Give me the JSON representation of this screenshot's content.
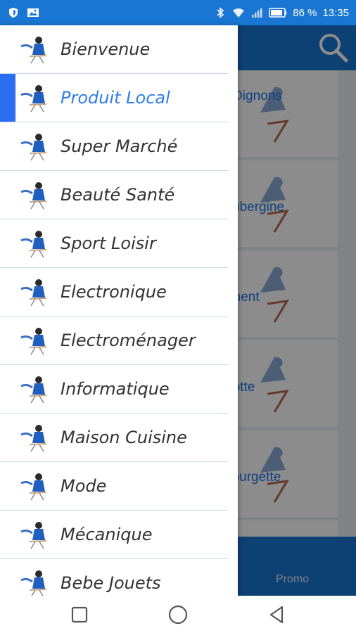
{
  "status_bar": {
    "battery": "86 %",
    "time": "13:35",
    "icons": [
      "shield-icon",
      "image-icon",
      "bluetooth-icon",
      "wifi-icon",
      "signal-icon",
      "battery-icon"
    ]
  },
  "app": {
    "cards": [
      "Oignons",
      "ubergine",
      "l Piment",
      "Carotte",
      "e Courgette",
      ""
    ],
    "bottom_tab": "Promo",
    "search_icon": "search-icon",
    "colors": {
      "primary": "#1976d2",
      "accent": "#2f7ee8",
      "active_bar": "#2b6ef2"
    }
  },
  "drawer": {
    "items": [
      {
        "label": "Bienvenue",
        "active": false
      },
      {
        "label": "Produit Local",
        "active": true
      },
      {
        "label": "Super Marché",
        "active": false
      },
      {
        "label": "Beauté Santé",
        "active": false
      },
      {
        "label": "Sport Loisir",
        "active": false
      },
      {
        "label": "Electronique",
        "active": false
      },
      {
        "label": "Electroménager",
        "active": false
      },
      {
        "label": "Informatique",
        "active": false
      },
      {
        "label": "Maison Cuisine",
        "active": false
      },
      {
        "label": "Mode",
        "active": false
      },
      {
        "label": "Mécanique",
        "active": false
      },
      {
        "label": "Bebe Jouets",
        "active": false
      }
    ]
  },
  "nav_bar": {
    "buttons": [
      "recents-square-icon",
      "home-circle-icon",
      "back-triangle-icon"
    ]
  }
}
